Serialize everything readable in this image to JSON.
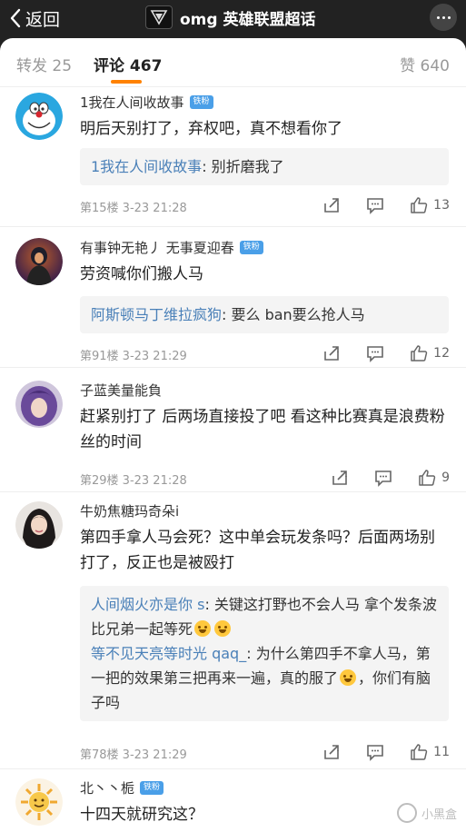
{
  "header": {
    "back_label": "返回",
    "title": "omg 英雄联盟超话"
  },
  "tabs": {
    "repost": "转发 25",
    "comments": "评论 467",
    "likes": "赞 640"
  },
  "colors": {
    "accent": "#ff8200",
    "reply_name": "#4a80b8",
    "badge": "#4a9fe8"
  },
  "comments": [
    {
      "user": "1我在人间收故事",
      "badge": "铁粉",
      "text": "明后天别打了，弃权吧，真不想看你了",
      "replies": [
        {
          "name": "1我在人间收故事",
          "text": ": 别折磨我了"
        }
      ],
      "meta": "第15楼  3-23 21:28",
      "likes": "13",
      "avatar_icon": "doraemon-avatar-icon"
    },
    {
      "user": "有事钟无艳丿 无事夏迎春",
      "badge": "铁粉",
      "text": "劳资喊你们搬人马",
      "replies": [
        {
          "name": "阿斯顿马丁维拉疯狗",
          "text": ": 要么 ban要么抢人马"
        }
      ],
      "meta": "第91楼  3-23 21:29",
      "likes": "12",
      "avatar_icon": "character-avatar-icon"
    },
    {
      "user": "子蓝美量能負",
      "badge": "",
      "text": "赶紧别打了 后两场直接投了吧 看这种比赛真是浪费粉丝的时间",
      "replies": [],
      "meta": "第29楼  3-23 21:28",
      "likes": "9",
      "avatar_icon": "purple-hair-avatar-icon"
    },
    {
      "user": "牛奶焦糖玛奇朵i",
      "badge": "",
      "text": "第四手拿人马会死？这中单会玩发条吗？后面两场别打了，反正也是被殴打",
      "replies": [
        {
          "name": "人间烟火亦是你 s",
          "text": ": 关键这打野也不会人马 拿个发条波比兄弟一起等死"
        },
        {
          "name": "等不见天亮等时光 qaq_",
          "text": ": 为什么第四手不拿人马，第一把的效果第三把再来一遍，真的服了"
        }
      ],
      "reply_tail": "，你们有脑子吗",
      "meta": "第78楼  3-23 21:29",
      "likes": "11",
      "avatar_icon": "girl-avatar-icon"
    },
    {
      "user": "北丶丶栀",
      "badge": "铁粉",
      "text": "十四天就研究这？",
      "replies": [],
      "meta": "",
      "likes": "",
      "avatar_icon": "sun-avatar-icon"
    }
  ],
  "watermark": "小黑盒"
}
